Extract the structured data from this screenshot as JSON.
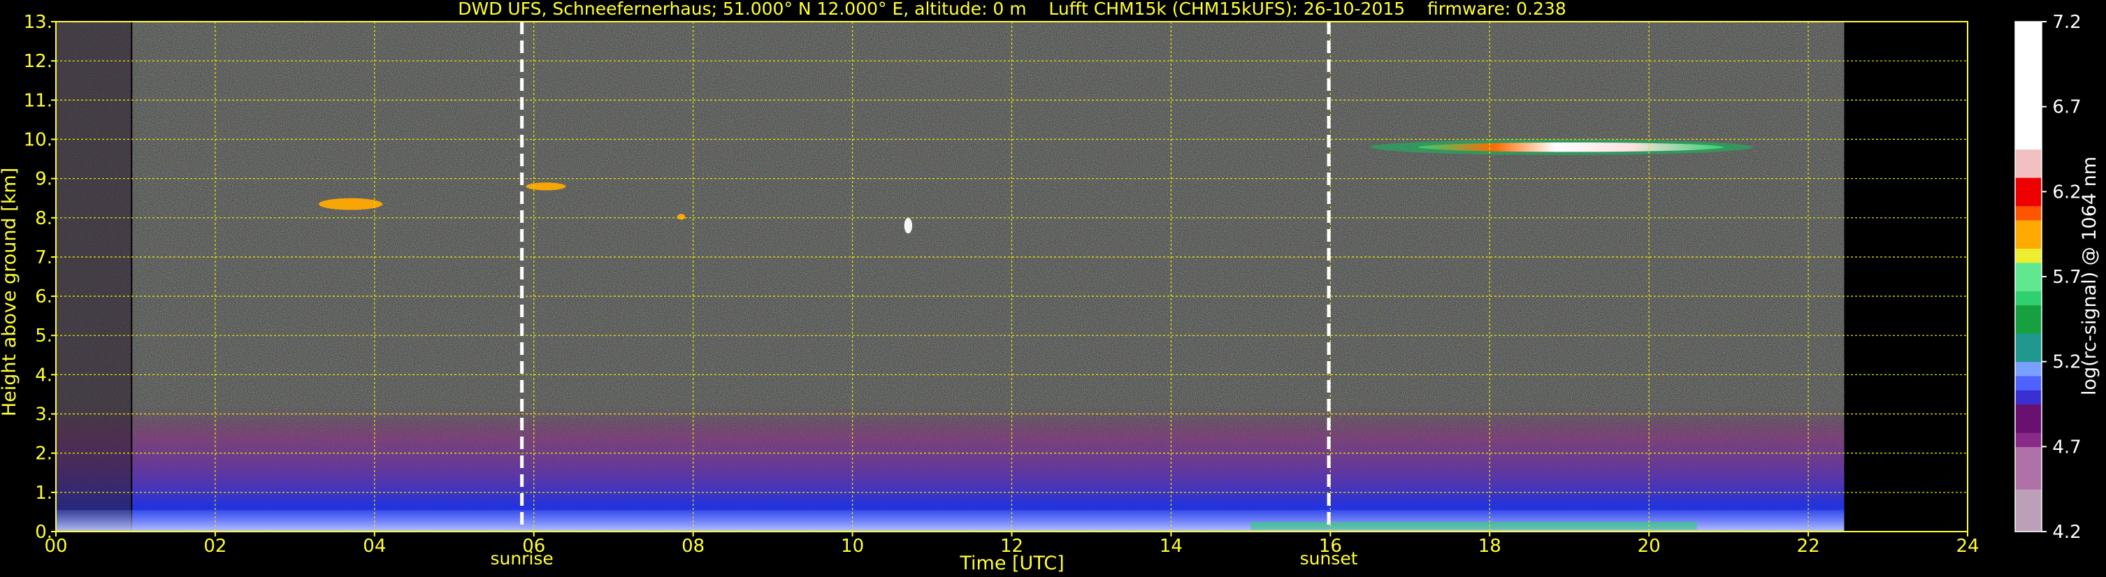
{
  "chart_data": {
    "type": "heatmap",
    "title": "DWD UFS, Schneefernerhaus; 51.000° N 12.000° E, altitude: 0 m    Lufft CHM15k (CHM15kUFS): 26-10-2015    firmware: 0.238",
    "xlabel": "Time [UTC]",
    "ylabel": "Height above ground [km]",
    "colorbar_label": "log(rc-signal) @ 1064 nm",
    "xlim": [
      0,
      24
    ],
    "ylim": [
      0,
      13
    ],
    "x_tick_values": [
      0,
      2,
      4,
      6,
      8,
      10,
      12,
      14,
      16,
      18,
      20,
      22,
      24
    ],
    "x_tick_labels": [
      "00",
      "02",
      "04",
      "06",
      "08",
      "10",
      "12",
      "14",
      "16",
      "18",
      "20",
      "22",
      "24"
    ],
    "y_tick_values": [
      0,
      1,
      2,
      3,
      4,
      5,
      6,
      7,
      8,
      9,
      10,
      11,
      12,
      13
    ],
    "y_tick_labels": [
      "0.",
      "1.",
      "2.",
      "3.",
      "4.",
      "5.",
      "6.",
      "7.",
      "8.",
      "9.",
      "10.",
      "11.",
      "12.",
      "13."
    ],
    "grid": true,
    "data_coverage_hours": [
      0,
      22.45
    ],
    "instrument_start_hour": 0.95,
    "markers": [
      {
        "label": "sunrise",
        "x": 5.85
      },
      {
        "label": "sunset",
        "x": 15.98
      }
    ],
    "colorbar": {
      "range": [
        4.2,
        7.2
      ],
      "tick_values": [
        4.2,
        4.7,
        5.2,
        5.7,
        6.2,
        6.7,
        7.2
      ],
      "tick_labels": [
        "4.2",
        "4.7",
        "5.2",
        "5.7",
        "6.2",
        "6.7",
        "7.2"
      ]
    },
    "features": [
      {
        "x": [
          16.5,
          21.3
        ],
        "y": [
          9.6,
          10.0
        ],
        "level": 6.3
      },
      {
        "x": [
          3.3,
          4.1
        ],
        "y": [
          8.2,
          8.5
        ],
        "level": 5.9
      },
      {
        "x": [
          5.9,
          6.4
        ],
        "y": [
          8.7,
          8.9
        ],
        "level": 6.0
      },
      {
        "x": [
          7.8,
          7.9
        ],
        "y": [
          7.95,
          8.1
        ],
        "level": 6.0
      },
      {
        "x": [
          10.65,
          10.75
        ],
        "y": [
          7.6,
          8.0
        ],
        "level": 7.2
      }
    ],
    "colors": {
      "background": "#000000",
      "text": "#ffff33",
      "colorbar_text": "#ffffff",
      "grid": "#e8e800",
      "marker": "#ffffff"
    }
  }
}
